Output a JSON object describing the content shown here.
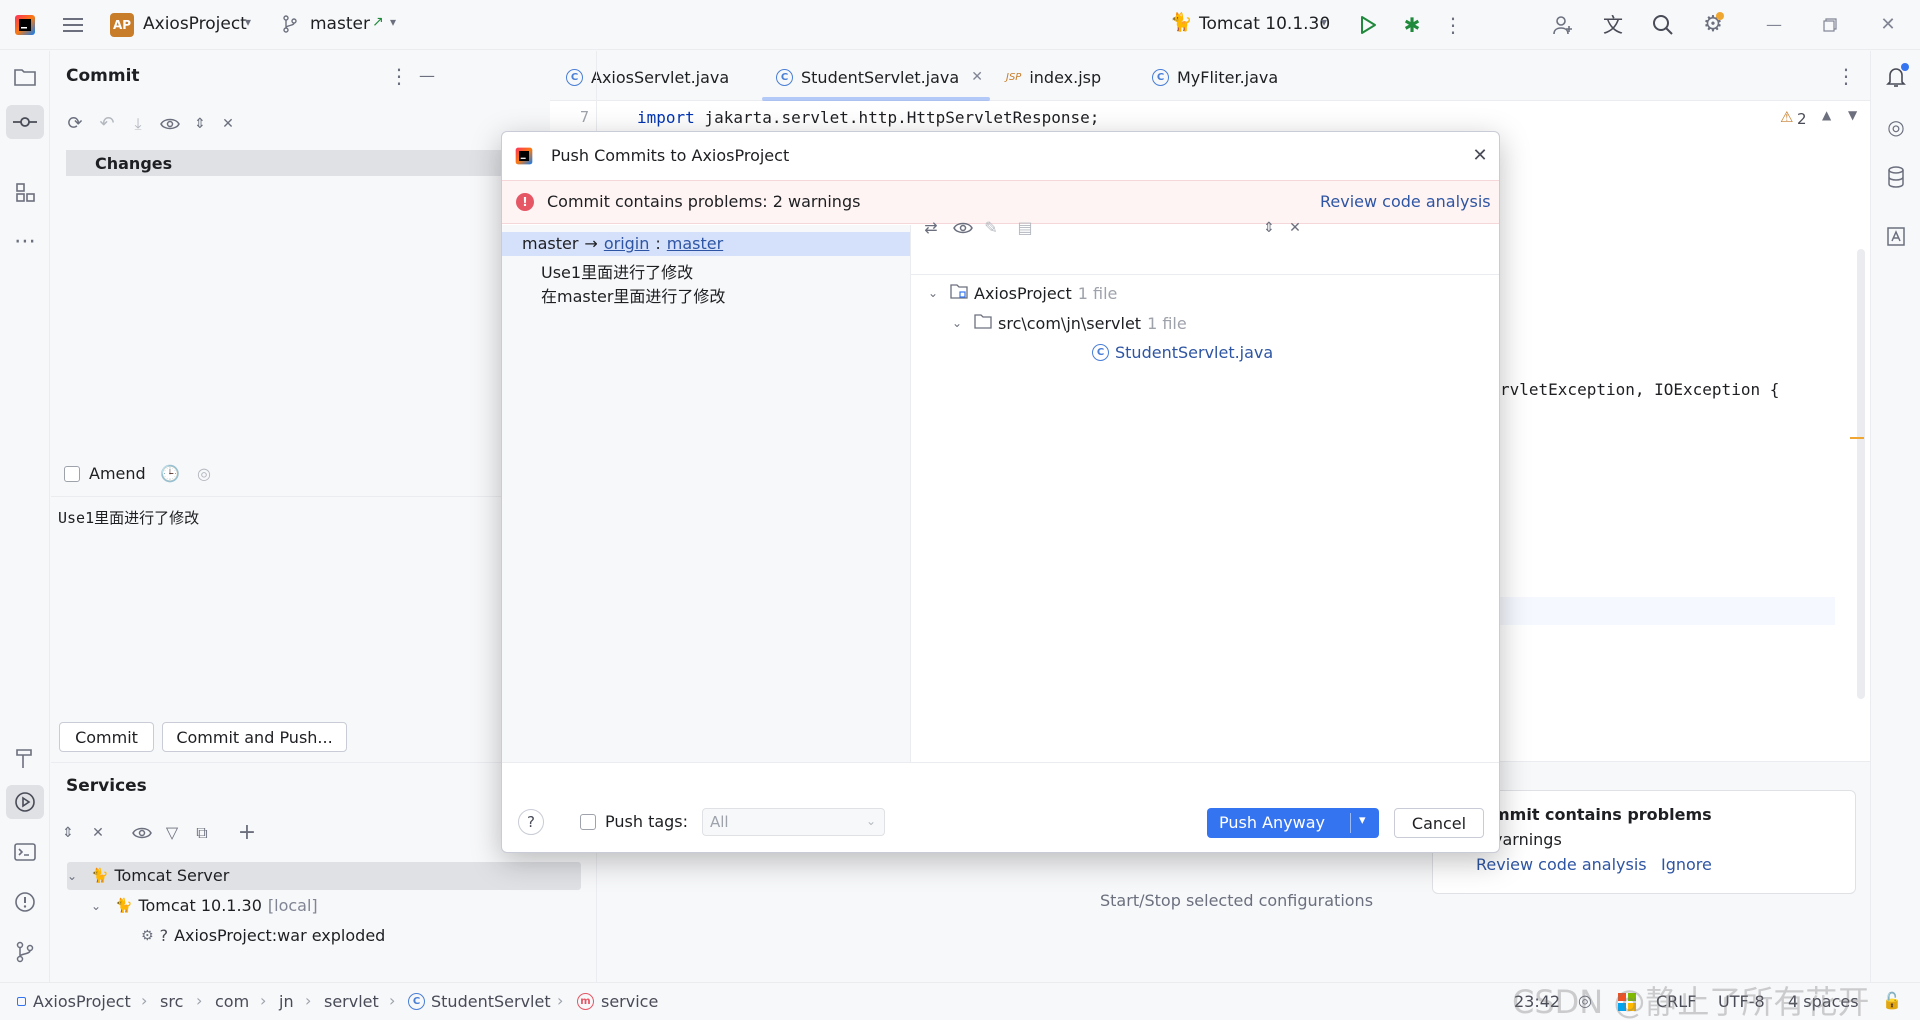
{
  "titlebar": {
    "project_badge": "AP",
    "project_name": "AxiosProject",
    "branch": "master",
    "run_config": "Tomcat 10.1.30"
  },
  "commit_panel": {
    "title": "Commit",
    "changes_label": "Changes",
    "amend_label": "Amend",
    "commit_message": "Use1里面进行了修改",
    "commit_button": "Commit",
    "commit_push_button": "Commit and Push..."
  },
  "editor": {
    "tabs": [
      {
        "label": "AxiosServlet.java"
      },
      {
        "label": "StudentServlet.java"
      },
      {
        "label": "index.jsp"
      },
      {
        "label": "MyFliter.java"
      }
    ],
    "line_number": "7",
    "code_keyword": "import",
    "code_rest": " jakarta.servlet.http.HttpServletResponse;",
    "code_line_2": "rvletException, IOException {",
    "warning_count": "2",
    "services_hint": "Start/Stop selected configurations"
  },
  "services": {
    "title": "Services",
    "tree": [
      {
        "label": "Tomcat Server"
      },
      {
        "label": "Tomcat 10.1.30",
        "suffix": "[local]"
      },
      {
        "label": "AxiosProject:war exploded",
        "prefix": "?"
      }
    ]
  },
  "dialog": {
    "title": "Push Commits to AxiosProject",
    "warning_text": "Commit contains problems: 2 warnings",
    "review_link": "Review code analysis",
    "branch_source": "master",
    "arrow": "→",
    "remote": "origin",
    "colon": ":",
    "remote_branch": "master",
    "commits": [
      "Use1里面进行了修改",
      "在master里面进行了修改"
    ],
    "files_tree": [
      {
        "label": "AxiosProject",
        "count": "1 file"
      },
      {
        "label": "src\\com\\jn\\servlet",
        "count": "1 file"
      },
      {
        "label": "StudentServlet.java",
        "count": ""
      }
    ],
    "push_tags_label": "Push tags:",
    "push_tags_value": "All",
    "push_anyway_button": "Push Anyway",
    "cancel_button": "Cancel",
    "help_label": "?"
  },
  "notification": {
    "title": "mmit contains problems",
    "body": "varnings",
    "review_link": "Review code analysis",
    "ignore_link": "Ignore"
  },
  "statusbar": {
    "breadcrumbs": [
      "AxiosProject",
      "src",
      "com",
      "jn",
      "servlet",
      "StudentServlet",
      "service"
    ],
    "time": "23:42",
    "line_sep": "CRLF",
    "encoding": "UTF-8",
    "indent": "4 spaces",
    "watermark": "CSDN @静止了所有花开"
  },
  "colors": {
    "accent": "#3574f0",
    "link": "#2e55a3",
    "warning_bg": "#fff4f4",
    "error": "#e55765",
    "selection": "#d5e1fb"
  }
}
